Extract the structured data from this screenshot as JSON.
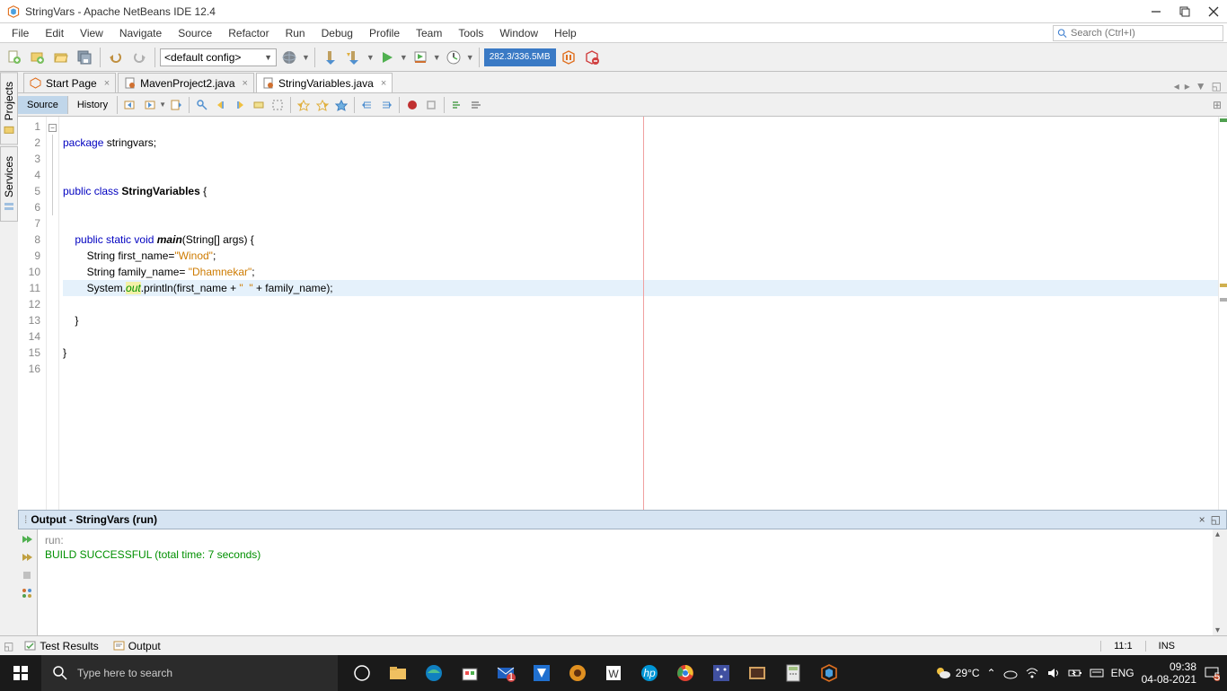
{
  "title": "StringVars - Apache NetBeans IDE 12.4",
  "menus": [
    "File",
    "Edit",
    "View",
    "Navigate",
    "Source",
    "Refactor",
    "Run",
    "Debug",
    "Profile",
    "Team",
    "Tools",
    "Window",
    "Help"
  ],
  "search_placeholder": "Search (Ctrl+I)",
  "config_label": "<default config>",
  "memory": "282.3/336.5MB",
  "editor_tabs": [
    {
      "label": "Start Page",
      "active": false
    },
    {
      "label": "MavenProject2.java",
      "active": false
    },
    {
      "label": "StringVariables.java",
      "active": true
    }
  ],
  "view_tabs": {
    "source": "Source",
    "history": "History"
  },
  "side_tabs": [
    "Projects",
    "Services"
  ],
  "code": {
    "lines": [
      {
        "n": 1,
        "html": ""
      },
      {
        "n": 2,
        "html": "<span class='kw'>package</span> stringvars;"
      },
      {
        "n": 3,
        "html": ""
      },
      {
        "n": 4,
        "html": ""
      },
      {
        "n": 5,
        "html": "<span class='kw'>public</span> <span class='kw'>class</span> <b>StringVariables</b> {"
      },
      {
        "n": 6,
        "html": ""
      },
      {
        "n": 7,
        "html": ""
      },
      {
        "n": 8,
        "html": "    <span class='kw'>public</span> <span class='kw'>static</span> <span class='kw'>void</span> <span class='mname'>main</span>(String[] args) {",
        "fold": "-"
      },
      {
        "n": 9,
        "html": "        String first_name=<span class='str'>\"Winod\"</span>;"
      },
      {
        "n": 10,
        "html": "        String family_name= <span class='str'>\"Dhamnekar\"</span>;"
      },
      {
        "n": 11,
        "html": "        System.<span class='fld'>out</span>.println(first_name + <span class='str'>\"  \"</span> + family_name);",
        "hl": true
      },
      {
        "n": 12,
        "html": ""
      },
      {
        "n": 13,
        "html": "    }"
      },
      {
        "n": 14,
        "html": ""
      },
      {
        "n": 15,
        "html": "}"
      },
      {
        "n": 16,
        "html": ""
      }
    ]
  },
  "output": {
    "title": "Output - StringVars (run)",
    "lines": [
      {
        "text": "run:",
        "cls": ""
      },
      {
        "text": "BUILD SUCCESSFUL (total time: 7 seconds)",
        "cls": "bsucc"
      }
    ]
  },
  "bottom_tabs": [
    "Test Results",
    "Output"
  ],
  "status": {
    "pos": "11:1",
    "ins": "INS"
  },
  "taskbar": {
    "search": "Type here to search",
    "weather_temp": "29°C",
    "lang": "ENG",
    "time": "09:38",
    "date": "04-08-2021"
  }
}
